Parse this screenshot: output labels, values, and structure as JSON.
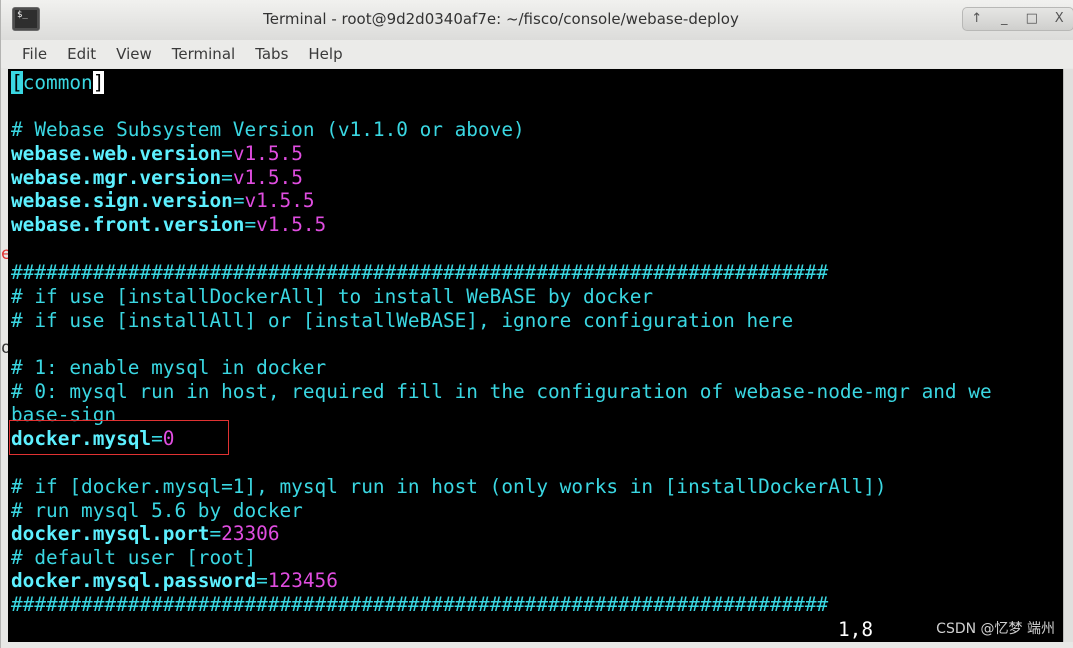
{
  "window": {
    "title": "Terminal - root@9d2d0340af7e: ~/fisco/console/webase-deploy",
    "app_icon_glyph": "$_",
    "controls": [
      "↑",
      "_",
      "□",
      "X"
    ]
  },
  "menubar": {
    "items": [
      "File",
      "Edit",
      "View",
      "Terminal",
      "Tabs",
      "Help"
    ]
  },
  "terminal": {
    "section_open": "[",
    "section_name": "common",
    "section_close": "]",
    "comment_version": "# Webase Subsystem Version (v1.1.0 or above)",
    "web_version": {
      "key": "webase.web.version",
      "eq": "=",
      "value": "v1.5.5"
    },
    "mgr_version": {
      "key": "webase.mgr.version",
      "eq": "=",
      "value": "v1.5.5"
    },
    "sign_version": {
      "key": "webase.sign.version",
      "eq": "=",
      "value": "v1.5.5"
    },
    "front_version": {
      "key": "webase.front.version",
      "eq": "=",
      "value": "v1.5.5"
    },
    "hash_line_1": "######################################################################",
    "comment_docker_all": "# if use [installDockerAll] to install WeBASE by docker",
    "comment_install_all": "# if use [installAll] or [installWeBASE], ignore configuration here",
    "comment_enable": "# 1: enable mysql in docker",
    "comment_host_1": "# 0: mysql run in host, required fill in the configuration of webase-node-mgr and we",
    "comment_host_2": "base-sign",
    "docker_mysql": {
      "key": "docker.mysql",
      "eq": "=",
      "value": "0"
    },
    "comment_if_docker": "# if [docker.mysql=1], mysql run in host (only works in [installDockerAll])",
    "comment_run_mysql": "# run mysql 5.6 by docker",
    "docker_mysql_port": {
      "key": "docker.mysql.port",
      "eq": "=",
      "value": "23306"
    },
    "comment_default_user": "# default user [root]",
    "docker_mysql_password": {
      "key": "docker.mysql.password",
      "eq": "=",
      "value": "123456"
    },
    "hash_line_2": "######################################################################",
    "cursor_position": "1,8"
  },
  "watermark": "CSDN @忆梦 端州",
  "colors": {
    "terminal_bg": "#000000",
    "text_cyan": "#3ad7e2",
    "key_bright_cyan": "#5df0ff",
    "value_magenta": "#e04de0",
    "highlight_red": "#e03232"
  }
}
